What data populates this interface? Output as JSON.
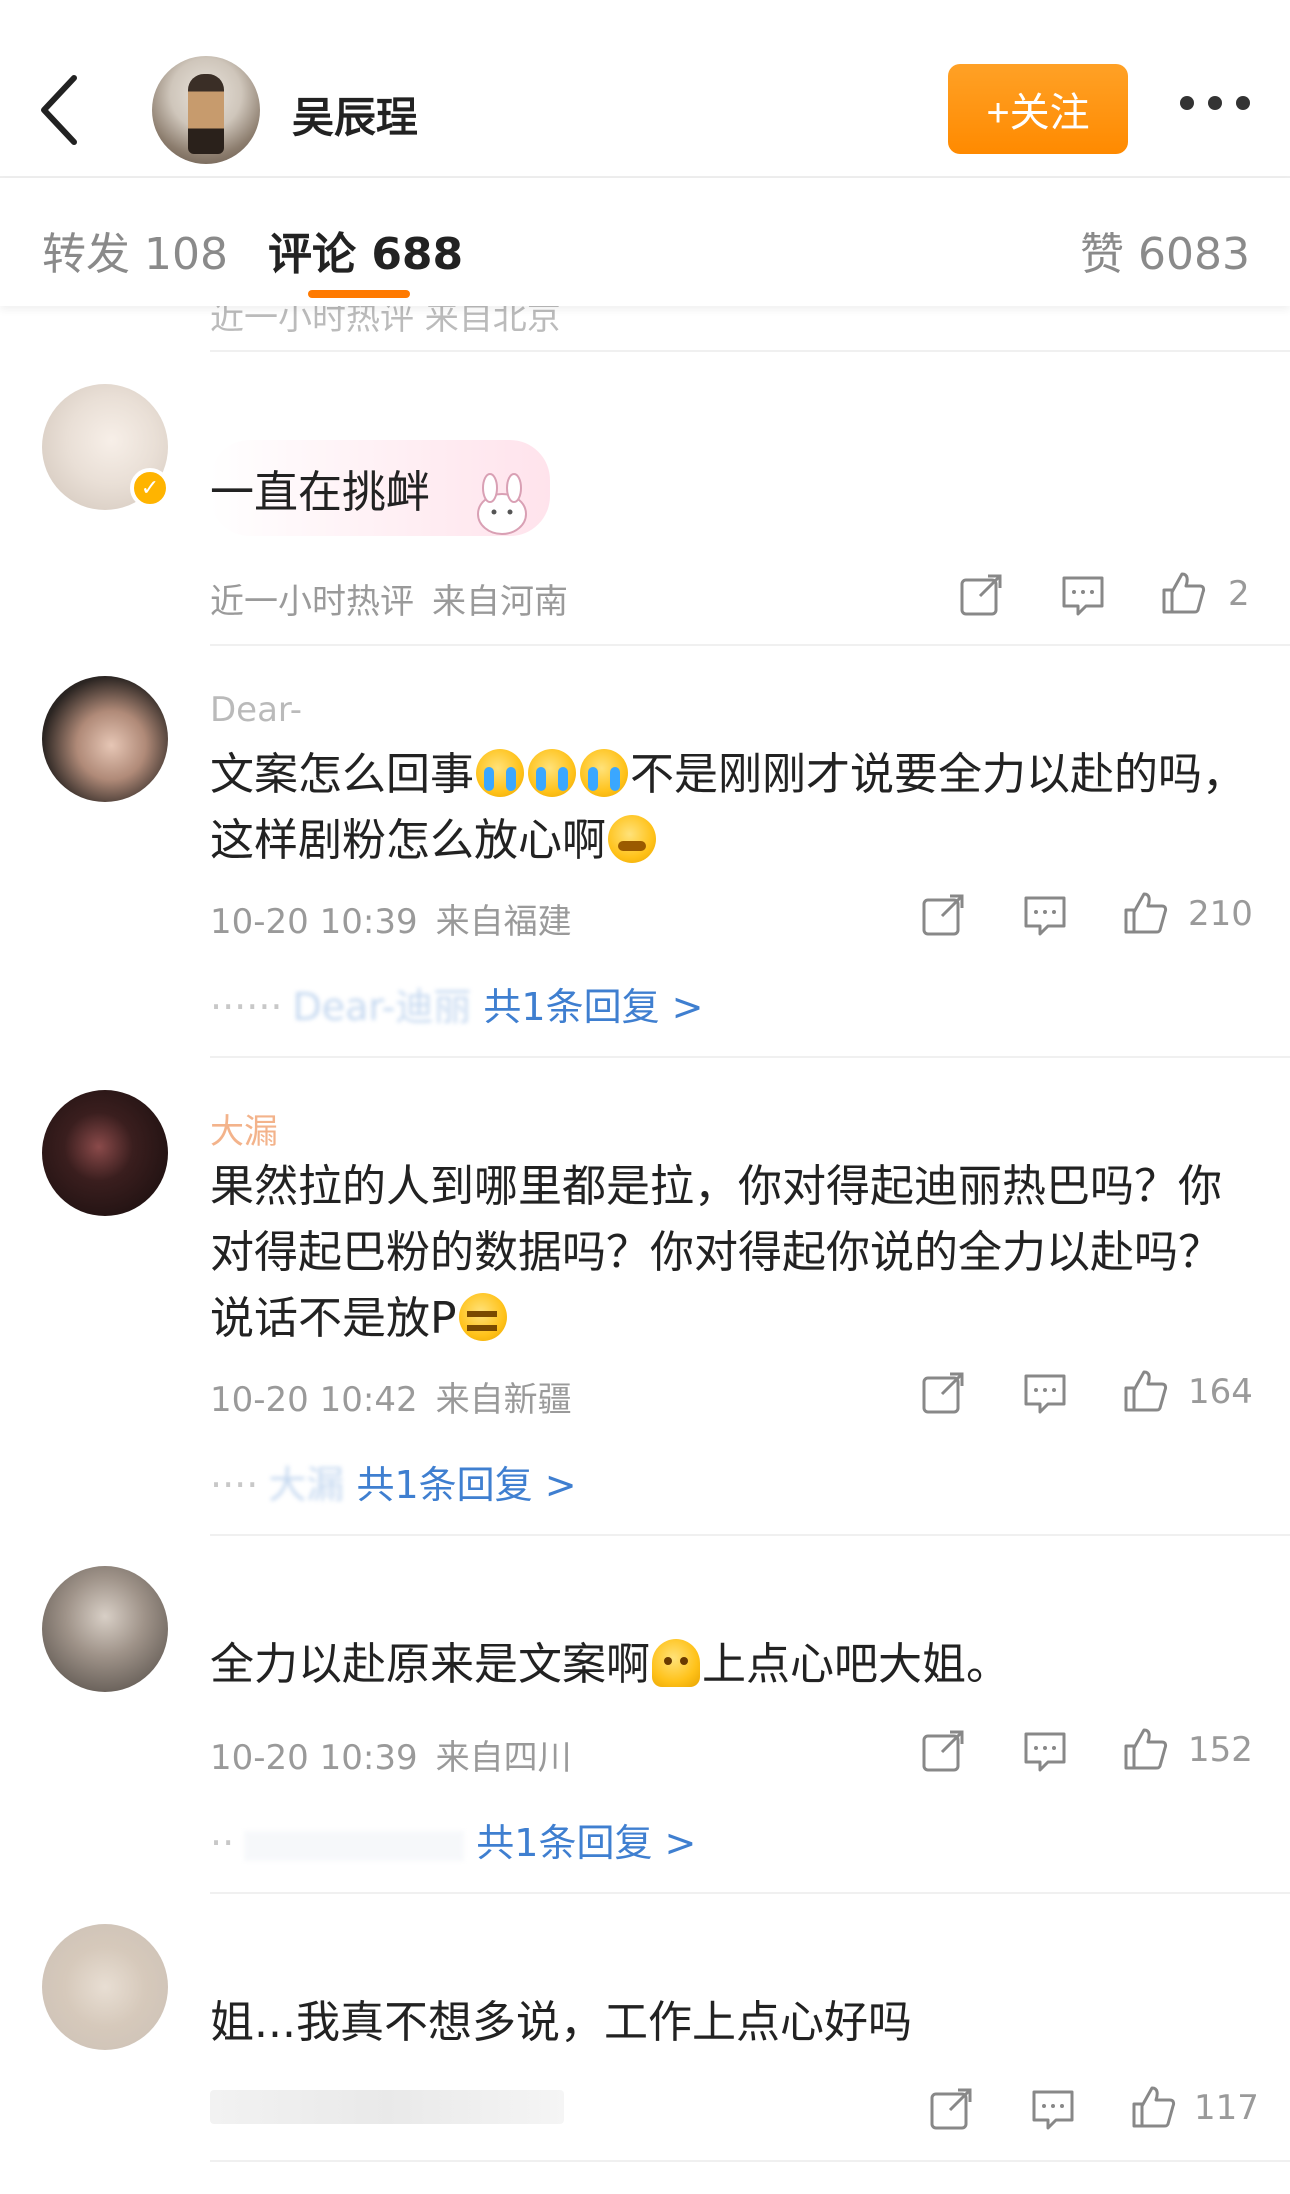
{
  "header": {
    "username": "吴辰珵",
    "follow_label": "+关注"
  },
  "tabs": [
    {
      "label": "转发 108"
    },
    {
      "label": "评论 688"
    },
    {
      "label": "赞 6083"
    }
  ],
  "cut_meta": "近一小时热评  来自北京",
  "comments": [
    {
      "username": "",
      "text": "一直在挑衅",
      "time": "近一小时热评",
      "location": "来自河南",
      "likes": "2"
    },
    {
      "username": "Dear-",
      "text_a": "文案怎么回事",
      "text_b": "不是刚刚才说要全力以赴的吗，这样剧粉怎么放心啊",
      "time": "10-20 10:39",
      "location": "来自福建",
      "likes": "210",
      "replies_prefix": "Dear-迪丽",
      "replies_label": "共1条回复 >"
    },
    {
      "username": "大漏",
      "text": "果然拉的人到哪里都是拉，你对得起迪丽热巴吗？你对得起巴粉的数据吗？你对得起你说的全力以赴吗？说话不是放P",
      "time": "10-20 10:42",
      "location": "来自新疆",
      "likes": "164",
      "replies_prefix": "大漏",
      "replies_label": "共1条回复 >"
    },
    {
      "username": "",
      "text_a": "全力以赴原来是文案啊",
      "text_b": "上点心吧大姐。",
      "time": "10-20 10:39",
      "location": "来自四川",
      "likes": "152",
      "replies_prefix": "",
      "replies_label": "共1条回复 >"
    },
    {
      "username": "",
      "text": "姐...我真不想多说，工作上点心好吗",
      "likes": "117"
    }
  ],
  "colors": {
    "accent": "#ff8a00",
    "link": "#3f7fd0",
    "meta": "#9a9a9a"
  },
  "icons": [
    "back-icon",
    "more-icon",
    "share-icon",
    "comment-icon",
    "like-icon"
  ]
}
